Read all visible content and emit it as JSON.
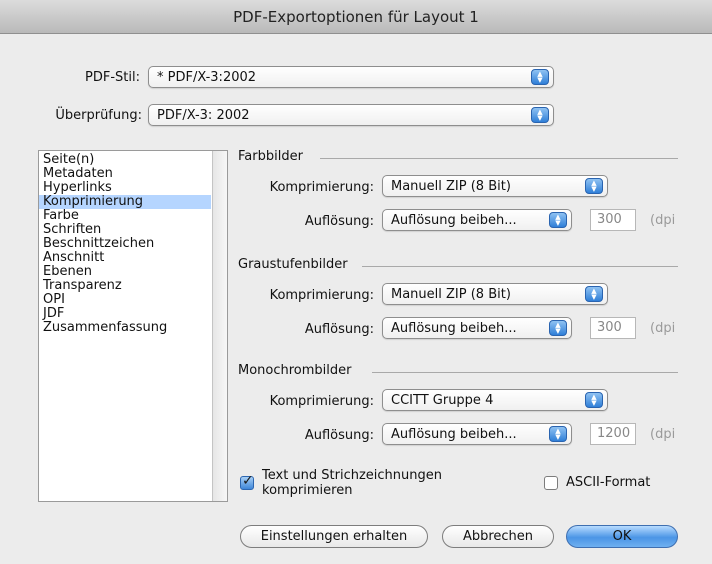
{
  "window": {
    "title": "PDF-Exportoptionen für Layout 1"
  },
  "top": {
    "pdf_style_label": "PDF-Stil:",
    "pdf_style_value": "* PDF/X-3:2002",
    "check_label": "Überprüfung:",
    "check_value": "PDF/X-3: 2002"
  },
  "sidebar": {
    "items": [
      "Seite(n)",
      "Metadaten",
      "Hyperlinks",
      "Komprimierung",
      "Farbe",
      "Schriften",
      "Beschnittzeichen",
      "Anschnitt",
      "Ebenen",
      "Transparenz",
      "OPI",
      "JDF",
      "Zusammenfassung"
    ],
    "selected": "Komprimierung"
  },
  "groups": {
    "color": {
      "title": "Farbbilder",
      "compression_label": "Komprimierung:",
      "compression_value": "Manuell ZIP (8 Bit)",
      "resolution_label": "Auflösung:",
      "resolution_value": "Auflösung beibeh...",
      "dpi_value": "300",
      "unit": "(dpi"
    },
    "gray": {
      "title": "Graustufenbilder",
      "compression_label": "Komprimierung:",
      "compression_value": "Manuell ZIP (8 Bit)",
      "resolution_label": "Auflösung:",
      "resolution_value": "Auflösung beibeh...",
      "dpi_value": "300",
      "unit": "(dpi"
    },
    "mono": {
      "title": "Monochrombilder",
      "compression_label": "Komprimierung:",
      "compression_value": "CCITT Gruppe 4",
      "resolution_label": "Auflösung:",
      "resolution_value": "Auflösung beibeh...",
      "dpi_value": "1200",
      "unit": "(dpi"
    }
  },
  "options": {
    "compress_text_line1": "Text und Strichzeichnungen",
    "compress_text_line2": "komprimieren",
    "compress_text_checked": true,
    "ascii_label": "ASCII-Format",
    "ascii_checked": false
  },
  "buttons": {
    "keep_settings": "Einstellungen erhalten",
    "cancel": "Abbrechen",
    "ok": "OK"
  },
  "colors": {
    "selection": "#b5d5ff",
    "accent_blue": "#4b95e6"
  }
}
